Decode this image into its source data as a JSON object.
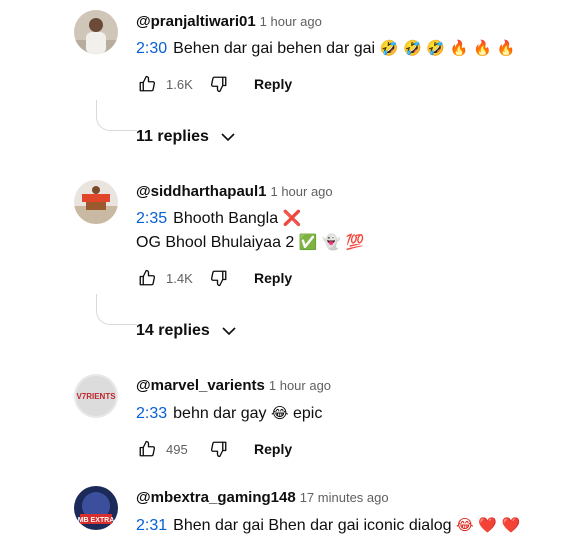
{
  "comments": [
    {
      "author": "@pranjaltiwari01",
      "time": "1 hour ago",
      "timestamp": "2:30",
      "text": "Behen dar gai behen dar gai",
      "emoji": "🤣 🤣 🤣 🔥 🔥 🔥",
      "likes": "1.6K",
      "reply_label": "Reply",
      "replies_label": "11 replies"
    },
    {
      "author": "@siddharthapaul1",
      "time": "1 hour ago",
      "timestamp": "2:35",
      "text": "Bhooth Bangla",
      "emoji": "❌",
      "line2": "OG Bhool Bhulaiyaa 2",
      "line2_emoji": "✅ 👻 💯",
      "likes": "1.4K",
      "reply_label": "Reply",
      "replies_label": "14 replies"
    },
    {
      "author": "@marvel_varients",
      "time": "1 hour ago",
      "timestamp": "2:33",
      "text": "behn dar gay",
      "emoji": "😂",
      "text_after": "epic",
      "likes": "495",
      "reply_label": "Reply",
      "avatar_text": "V7RIENTS"
    },
    {
      "author": "@mbextra_gaming148",
      "time": "17 minutes ago",
      "timestamp": "2:31",
      "text": "Bhen dar gai Bhen dar gai iconic dialog",
      "emoji": "😂 ❤️ ❤️",
      "avatar_text": "MB EXTRA"
    }
  ],
  "colors": {
    "timestamp": "#065fd4",
    "meta": "#606060",
    "thread_line": "#d9d9d9"
  }
}
